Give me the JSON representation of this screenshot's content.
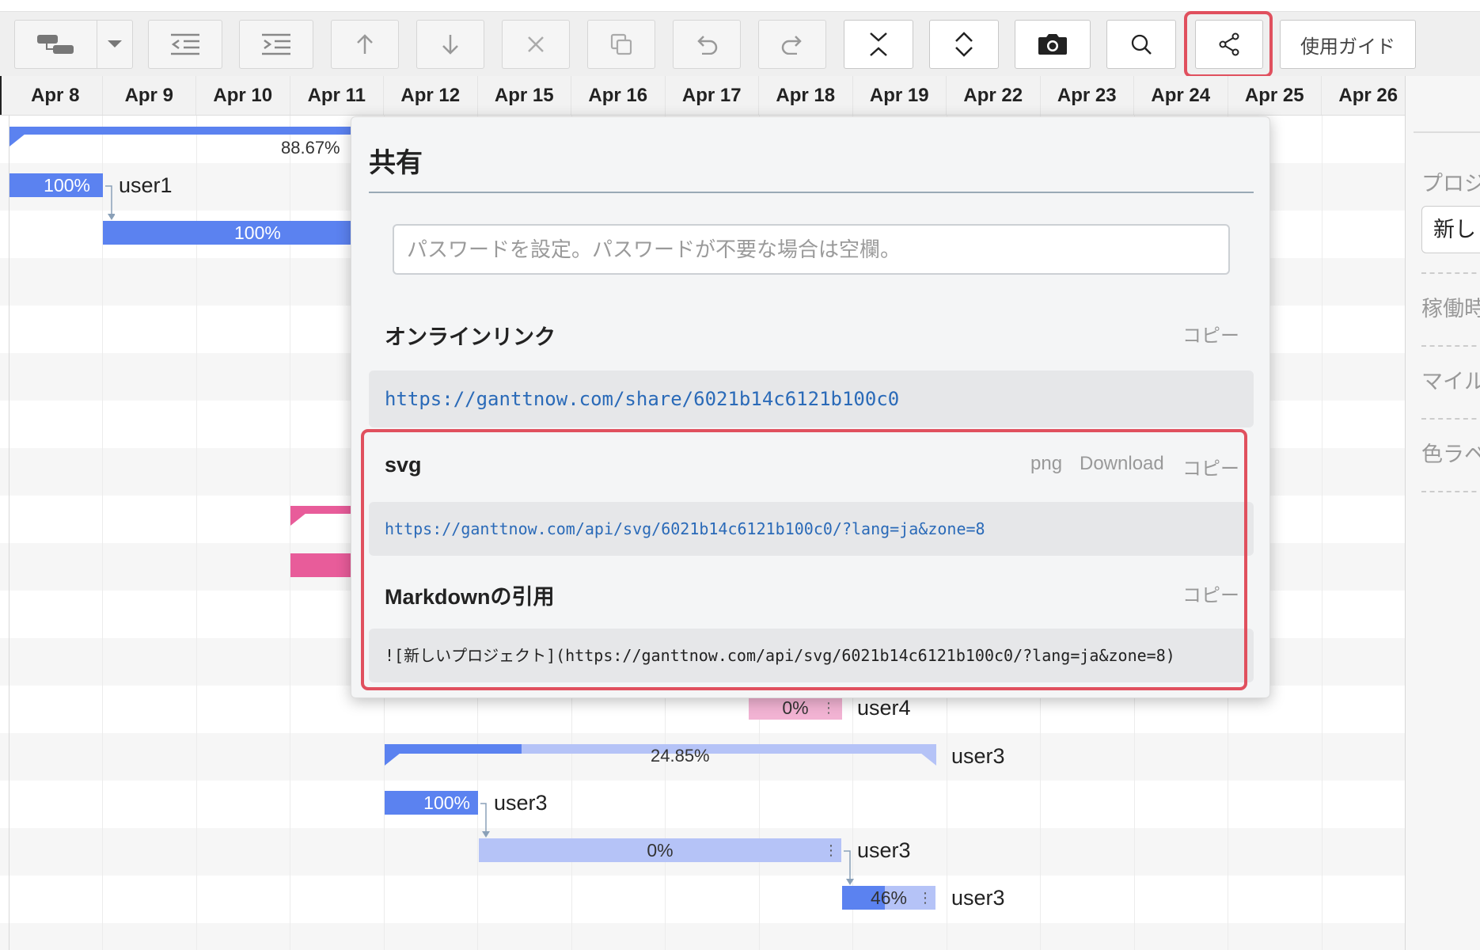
{
  "toolbar": {
    "guide_label": "使用ガイド",
    "buttons": [
      "task-add-icon",
      "caret-down-icon",
      "outdent-icon",
      "indent-icon",
      "arrow-up-icon",
      "arrow-down-icon",
      "delete-icon",
      "copy-icon",
      "undo-icon",
      "redo-icon",
      "collapse-icon",
      "expand-icon",
      "camera-icon",
      "search-icon",
      "share-icon"
    ]
  },
  "timeline": {
    "dates": [
      "Apr 8",
      "Apr 9",
      "Apr 10",
      "Apr 11",
      "Apr 12",
      "Apr 15",
      "Apr 16",
      "Apr 17",
      "Apr 18",
      "Apr 19",
      "Apr 22",
      "Apr 23",
      "Apr 24",
      "Apr 25",
      "Apr 26"
    ]
  },
  "gantt": {
    "summary1_pct": "88.67%",
    "task1_pct": "100%",
    "task1_user": "user1",
    "task2_pct": "100%",
    "task_user4_pct": "0%",
    "task_user4_user": "user4",
    "summary2_pct": "24.85%",
    "summary2_user": "user3",
    "task3_pct": "100%",
    "task3_user": "user3",
    "task4_pct": "0%",
    "task4_user": "user3",
    "task5_pct": "46%",
    "task5_user": "user3",
    "progress": {
      "summary1": 0.8867,
      "summary2": 0.2485,
      "task5": 0.46
    }
  },
  "right_panel": {
    "project_label": "プロジ",
    "project_name": "新し",
    "working_hours": "稼働時",
    "milestone": "マイル",
    "color_label": "色ラベ"
  },
  "share": {
    "title": "共有",
    "password_placeholder": "パスワードを設定。パスワードが不要な場合は空欄。",
    "online_link_label": "オンラインリンク",
    "copy": "コピー",
    "online_link": "https://ganttnow.com/share/6021b14c6121b100c0",
    "svg_label": "svg",
    "png": "png",
    "download": "Download",
    "svg_link": "https://ganttnow.com/api/svg/6021b14c6121b100c0/?lang=ja&zone=8",
    "markdown_label": "Markdownの引用",
    "markdown_text": "![新しいプロジェクト](https://ganttnow.com/api/svg/6021b14c6121b100c0/?lang=ja&zone=8)"
  },
  "colors": {
    "bar_dark": "#5b82f0",
    "bar_light": "#b5c3f7",
    "bar_pink": "#e85c9a",
    "bar_light_pink": "#f2b3d3",
    "highlight": "#e0505e",
    "link_blue": "#2a6ab8"
  }
}
